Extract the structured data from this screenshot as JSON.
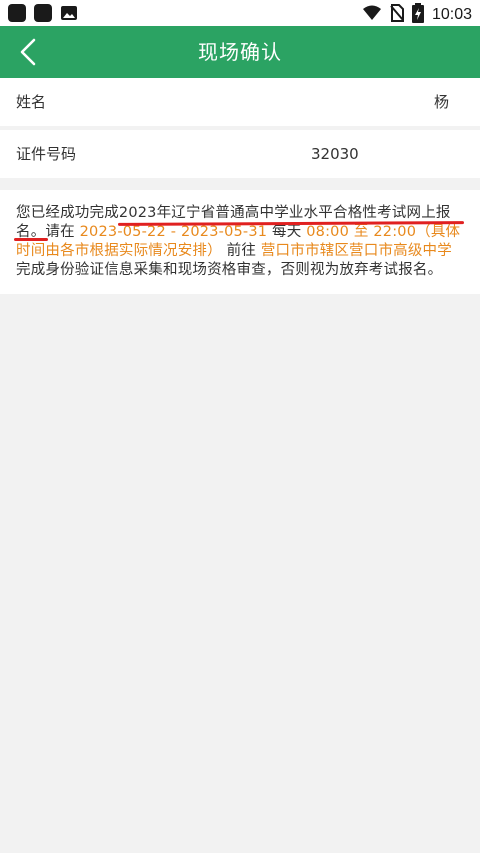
{
  "status_bar": {
    "time": "10:03",
    "icons": [
      "square-app-icon",
      "square-app-icon",
      "image-icon",
      "wifi-icon",
      "no-sim-icon",
      "battery-charging-icon"
    ]
  },
  "header": {
    "title": "现场确认",
    "back_icon": "chevron-left-icon",
    "color": "#2ba363"
  },
  "form": {
    "name_label": "姓名",
    "name_value": "杨",
    "id_label": "证件号码",
    "id_value": "32030"
  },
  "notice": {
    "p1": "您已经成功完成",
    "exam": "2023年辽宁省普通高中学业水平合格性考试网上报名",
    "p2": "。请在 ",
    "date_range": "2023-05-22 - 2023-05-31",
    "p3": " 每天 ",
    "time_range": "08:00 至 22:00（具体时间由各市根据实际情况安排）",
    "p4": " 前往 ",
    "location": "营口市市辖区营口市高级中学",
    "p5": " 完成身份验证信息采集和现场资格审查，否则视为放弃考试报名。",
    "highlight_color": "#e8891d",
    "underline_color": "#e02020"
  }
}
